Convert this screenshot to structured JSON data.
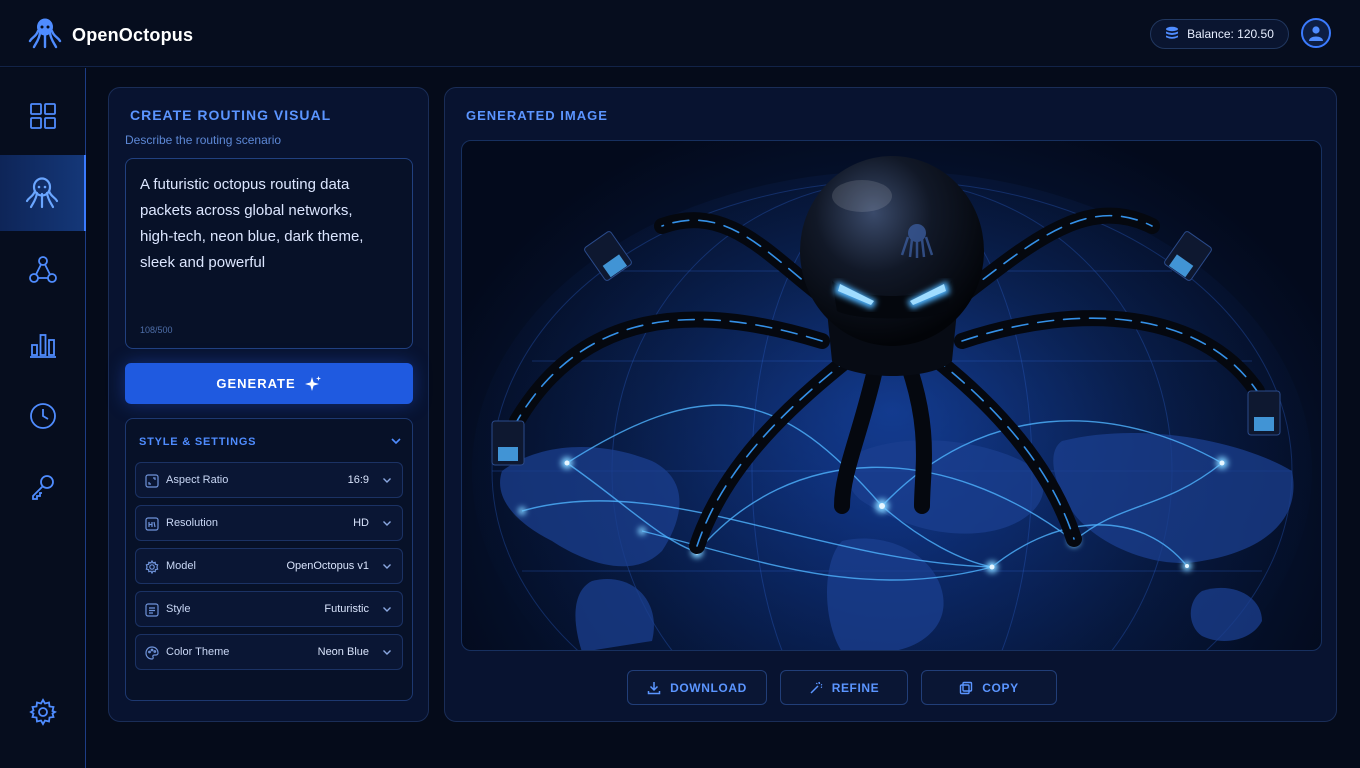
{
  "app": {
    "name": "OpenOctopus",
    "balance": "Balance: 120.50"
  },
  "sidebar": {
    "items": [
      {
        "icon": "dashboard-grid-icon"
      },
      {
        "icon": "octopus-icon",
        "active": true
      },
      {
        "icon": "network-nodes-icon"
      },
      {
        "icon": "bar-chart-icon"
      },
      {
        "icon": "clock-icon"
      },
      {
        "icon": "key-icon"
      }
    ],
    "settings_icon": "gear-icon"
  },
  "create": {
    "title": "CREATE ROUTING VISUAL",
    "prompt_label": "Describe the routing scenario",
    "prompt_value": "A futuristic octopus routing data packets across global networks, high-tech, neon blue, dark theme, sleek and powerful",
    "char_count": "108/500",
    "generate_label": "GENERATE"
  },
  "settings": {
    "title": "STYLE & SETTINGS",
    "rows": [
      {
        "label": "Aspect Ratio",
        "value": "16:9",
        "icon": "aspect-ratio-icon"
      },
      {
        "label": "Resolution",
        "value": "HD",
        "icon": "resolution-icon"
      },
      {
        "label": "Model",
        "value": "OpenOctopus v1",
        "icon": "model-gear-icon"
      },
      {
        "label": "Style",
        "value": "Futuristic",
        "icon": "style-icon"
      },
      {
        "label": "Color Theme",
        "value": "Neon Blue",
        "icon": "palette-icon"
      }
    ]
  },
  "output": {
    "title": "GENERATED IMAGE",
    "actions": {
      "download": "DOWNLOAD",
      "refine": "REFINE",
      "copy": "COPY"
    }
  },
  "colors": {
    "accent": "#3b7bff",
    "background": "#050b1a",
    "panel": "#081330",
    "neon": "#4fb4ff"
  }
}
